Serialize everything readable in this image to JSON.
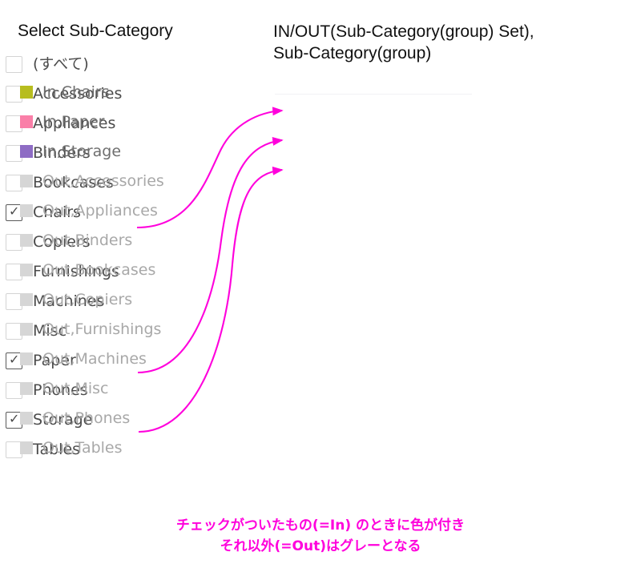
{
  "colors": {
    "annotation_magenta": "#ff00dc",
    "in_chairs": "#b7bd1f",
    "in_paper": "#fa7fa8",
    "in_storage": "#8e6cc4",
    "out_gray_swatch": "#d6d6d6",
    "out_gray_text": "#a8a8a8",
    "label_text": "#4b4b4b",
    "title_text": "#111111",
    "checkbox_border": "#d4d4d4",
    "checkbox_border_checked": "#5a5a5a",
    "separator": "#f2f2f4"
  },
  "filter": {
    "title": "Select Sub-Category",
    "items": [
      {
        "label": "(すべて)",
        "checked": false
      },
      {
        "label": "Accessories",
        "checked": false
      },
      {
        "label": "Appliances",
        "checked": false
      },
      {
        "label": "Binders",
        "checked": false
      },
      {
        "label": "Bookcases",
        "checked": false
      },
      {
        "label": "Chairs",
        "checked": true
      },
      {
        "label": "Copiers",
        "checked": false
      },
      {
        "label": "Furnishings",
        "checked": false
      },
      {
        "label": "Machines",
        "checked": false
      },
      {
        "label": "Misc",
        "checked": false
      },
      {
        "label": "Paper",
        "checked": true
      },
      {
        "label": "Phones",
        "checked": false
      },
      {
        "label": "Storage",
        "checked": true
      },
      {
        "label": "Tables",
        "checked": false
      }
    ],
    "check_glyph": "✓"
  },
  "legend": {
    "title_line1": "IN/OUT(Sub-Category(group) Set),",
    "title_line2": "Sub-Category(group)",
    "items": [
      {
        "label": "In,Chairs",
        "color": "#b7bd1f",
        "text_color": "#6e6e6e",
        "state": "in"
      },
      {
        "label": "In,Paper",
        "color": "#fa7fa8",
        "text_color": "#6e6e6e",
        "state": "in"
      },
      {
        "label": "In,Storage",
        "color": "#8e6cc4",
        "text_color": "#6e6e6e",
        "state": "in"
      },
      {
        "label": "Out,Accessories",
        "color": "#d6d6d6",
        "text_color": "#a8a8a8",
        "state": "out"
      },
      {
        "label": "Out,Appliances",
        "color": "#d6d6d6",
        "text_color": "#a8a8a8",
        "state": "out"
      },
      {
        "label": "Out,Binders",
        "color": "#d6d6d6",
        "text_color": "#a8a8a8",
        "state": "out"
      },
      {
        "label": "Out,Bookcases",
        "color": "#d6d6d6",
        "text_color": "#a8a8a8",
        "state": "out"
      },
      {
        "label": "Out,Copiers",
        "color": "#d6d6d6",
        "text_color": "#a8a8a8",
        "state": "out"
      },
      {
        "label": "Out,Furnishings",
        "color": "#d6d6d6",
        "text_color": "#a8a8a8",
        "state": "out"
      },
      {
        "label": "Out,Machines",
        "color": "#d6d6d6",
        "text_color": "#a8a8a8",
        "state": "out"
      },
      {
        "label": "Out,Misc",
        "color": "#d6d6d6",
        "text_color": "#a8a8a8",
        "state": "out"
      },
      {
        "label": "Out,Phones",
        "color": "#d6d6d6",
        "text_color": "#a8a8a8",
        "state": "out"
      },
      {
        "label": "Out,Tables",
        "color": "#d6d6d6",
        "text_color": "#a8a8a8",
        "state": "out"
      }
    ]
  },
  "annotations": {
    "arrows": [
      {
        "from": "Chairs",
        "to": "In,Chairs"
      },
      {
        "from": "Paper",
        "to": "In,Paper"
      },
      {
        "from": "Storage",
        "to": "In,Storage"
      }
    ],
    "caption_line1": "チェックがついたもの(=In) のときに色が付き",
    "caption_line2": "それ以外(=Out)はグレーとなる"
  }
}
